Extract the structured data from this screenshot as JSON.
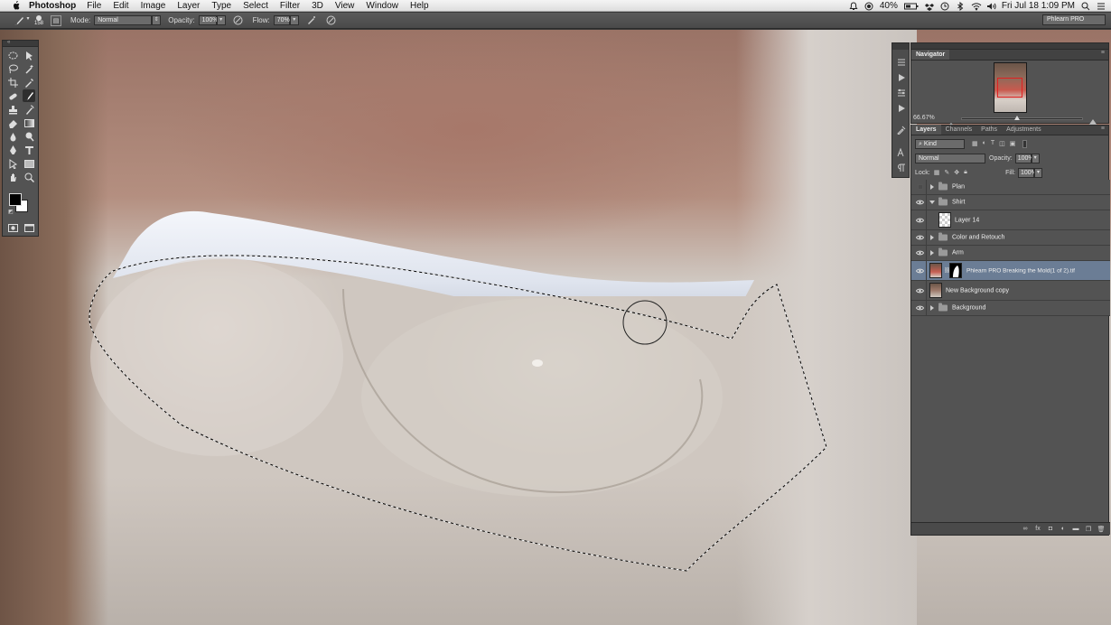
{
  "menubar": {
    "app_name": "Photoshop",
    "items": [
      "File",
      "Edit",
      "Image",
      "Layer",
      "Type",
      "Select",
      "Filter",
      "3D",
      "View",
      "Window",
      "Help"
    ],
    "battery": "40%",
    "datetime": "Fri Jul 18  1:09 PM"
  },
  "options": {
    "brush_size": "158",
    "mode_label": "Mode:",
    "mode_value": "Normal",
    "opacity_label": "Opacity:",
    "opacity_value": "100%",
    "flow_label": "Flow:",
    "flow_value": "70%",
    "workspace": "Phlearn PRO"
  },
  "navigator": {
    "title": "Navigator",
    "zoom": "66.67%"
  },
  "layers_panel": {
    "tabs": [
      "Layers",
      "Channels",
      "Paths",
      "Adjustments"
    ],
    "kind_label": "Kind",
    "blend_mode": "Normal",
    "opacity_label": "Opacity:",
    "opacity_value": "100%",
    "lock_label": "Lock:",
    "fill_label": "Fill:",
    "fill_value": "100%",
    "layers": [
      {
        "name": "Plan",
        "type": "group",
        "visible": false,
        "expanded": false
      },
      {
        "name": "Shirt",
        "type": "group",
        "visible": true,
        "expanded": true
      },
      {
        "name": "Layer 14",
        "type": "pixel",
        "visible": true,
        "indent": 1
      },
      {
        "name": "Color and Retouch",
        "type": "group",
        "visible": true,
        "expanded": false
      },
      {
        "name": "Arm",
        "type": "group",
        "visible": true,
        "expanded": false
      },
      {
        "name": "Phlearn PRO Breaking the Mold(1 of 2).tif",
        "type": "smart",
        "visible": true,
        "selected": true
      },
      {
        "name": "New Background copy",
        "type": "pixel",
        "visible": true
      },
      {
        "name": "Background",
        "type": "group",
        "visible": true,
        "expanded": false
      }
    ]
  },
  "colors": {
    "accent_selected_layer": "#6b7d95",
    "panel_bg": "#535353",
    "menubar_bg": "#ececec"
  }
}
